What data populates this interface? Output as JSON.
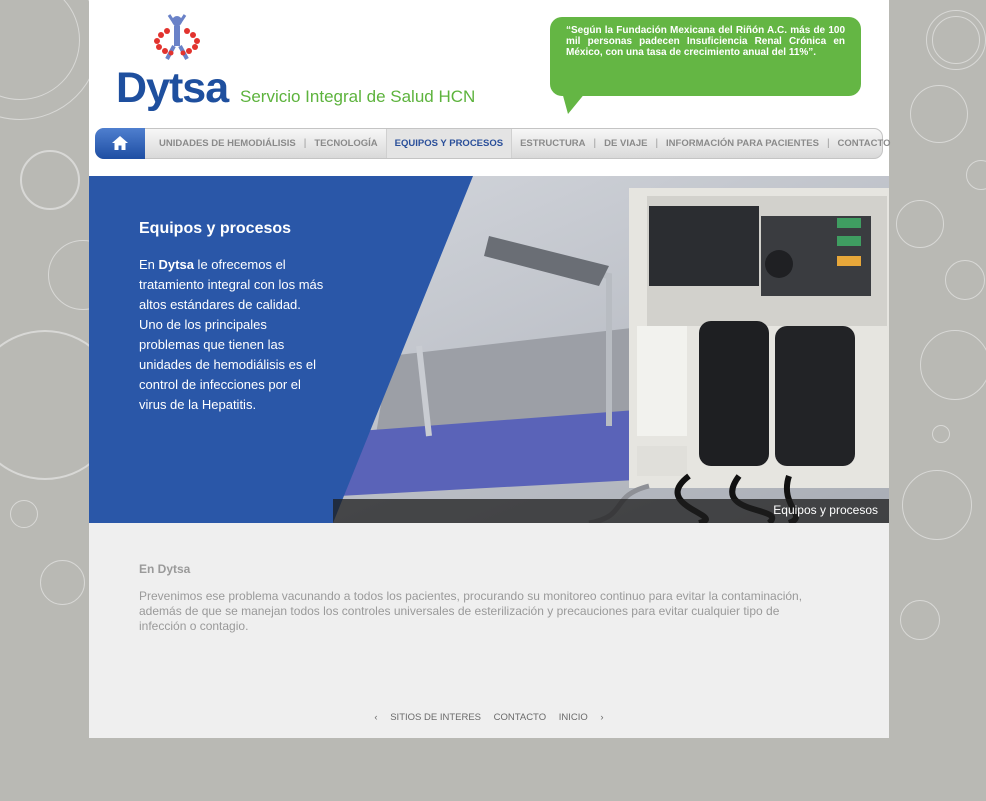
{
  "brand": {
    "name": "Dytsa",
    "tagline": "Servicio Integral de Salud HCN",
    "colors": {
      "blue": "#1e4f9e",
      "green": "#64b644"
    }
  },
  "quote": "“Según la Fundación Mexicana del Riñón A.C. más de 100 mil personas padecen Insuficiencia Renal Crónica en México, con una tasa de crecimiento anual del 11%”.",
  "nav": {
    "home_icon": "home-icon",
    "items": [
      "UNIDADES DE HEMODIÁLISIS",
      "TECNOLOGÍA",
      "EQUIPOS Y PROCESOS",
      "ESTRUCTURA",
      "DE VIAJE",
      "INFORMACIÓN PARA PACIENTES",
      "CONTACTO"
    ],
    "separator": "|",
    "active": "EQUIPOS Y PROCESOS"
  },
  "hero": {
    "title": "Equipos y procesos",
    "text_prefix": "En ",
    "text_brand": "Dytsa",
    "text_rest": " le ofrecemos el tratamiento integral con los más altos estándares de calidad. Uno de los principales problemas que tienen las unidades de hemodiálisis es el control de infecciones por el virus de la Hepatitis.",
    "caption": "Equipos y procesos"
  },
  "content": {
    "title": "En Dytsa",
    "body": "Prevenimos ese problema vacunando a todos los pacientes, procurando su monitoreo continuo para evitar la contaminación, además de que se manejan todos los controles universales de esterilización y precauciones para evitar cualquier tipo de infección o contagio."
  },
  "footer": {
    "prev": "‹",
    "links": [
      "SITIOS DE INTERES",
      "CONTACTO",
      "INICIO"
    ],
    "next": "›"
  }
}
